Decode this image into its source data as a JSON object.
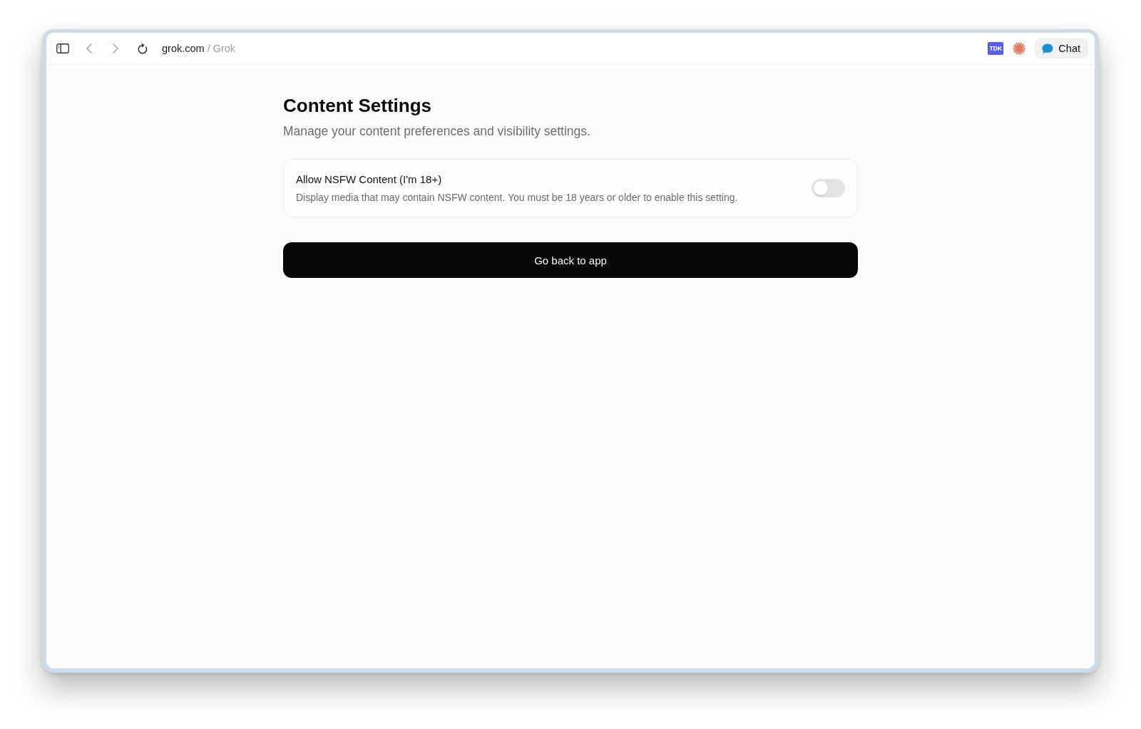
{
  "browser": {
    "url_domain": "grok.com",
    "url_separator": "/",
    "url_page": "Grok",
    "extensions": [
      {
        "kind": "badge",
        "label": "TDK"
      },
      {
        "kind": "sparkle"
      }
    ],
    "chat_button": {
      "label": "Chat"
    }
  },
  "page": {
    "title": "Content Settings",
    "subtitle": "Manage your content preferences and visibility settings.",
    "settings": [
      {
        "label": "Allow NSFW Content (I'm 18+)",
        "description": "Display media that may contain NSFW content. You must be 18 years or older to enable this setting.",
        "on": false
      }
    ],
    "back_button": {
      "label": "Go back to app"
    }
  }
}
